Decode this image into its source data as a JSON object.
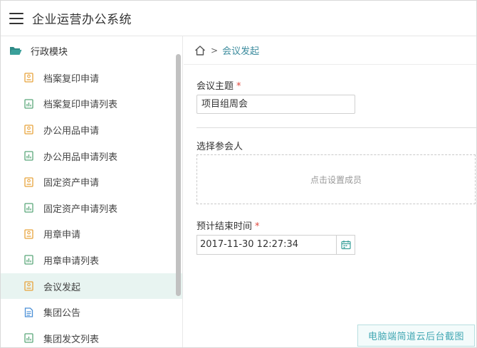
{
  "app": {
    "title": "企业运营办公系统"
  },
  "sidebar": {
    "group_label": "行政模块",
    "items": [
      {
        "label": "档案复印申请",
        "icon": "form-icon"
      },
      {
        "label": "档案复印申请列表",
        "icon": "list-icon"
      },
      {
        "label": "办公用品申请",
        "icon": "form-icon"
      },
      {
        "label": "办公用品申请列表",
        "icon": "list-icon"
      },
      {
        "label": "固定资产申请",
        "icon": "form-icon"
      },
      {
        "label": "固定资产申请列表",
        "icon": "list-icon"
      },
      {
        "label": "用章申请",
        "icon": "form-icon"
      },
      {
        "label": "用章申请列表",
        "icon": "list-icon"
      },
      {
        "label": "会议发起",
        "icon": "form-icon",
        "active": true
      },
      {
        "label": "集团公告",
        "icon": "document-icon"
      },
      {
        "label": "集团发文列表",
        "icon": "list-icon"
      }
    ]
  },
  "breadcrumb": {
    "separator": ">",
    "current": "会议发起"
  },
  "form": {
    "topic_label": "会议主题",
    "topic_value": "项目组周会",
    "participants_label": "选择参会人",
    "participants_placeholder": "点击设置成员",
    "end_time_label": "预计结束时间",
    "end_time_value": "2017-11-30 12:27:34",
    "required_mark": "*"
  },
  "watermark": "电脑端简道云后台截图",
  "colors": {
    "accent": "#3d8c9e",
    "active_bg": "#e8f4f1",
    "form_icon": "#e8a33c",
    "list_icon": "#5aa77a",
    "document_icon": "#4a8fd6",
    "required": "#e0473c"
  }
}
